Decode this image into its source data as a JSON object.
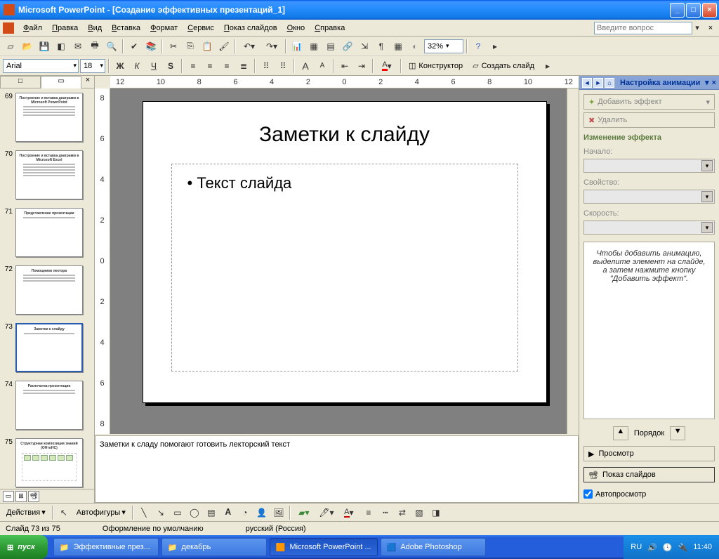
{
  "title": "Microsoft PowerPoint - [Создание эффективных презентаций_1]",
  "menubar": {
    "items": [
      "Файл",
      "Правка",
      "Вид",
      "Вставка",
      "Формат",
      "Сервис",
      "Показ слайдов",
      "Окно",
      "Справка"
    ],
    "ask_placeholder": "Введите вопрос"
  },
  "standard_toolbar": {
    "zoom": "32%"
  },
  "formatting_toolbar": {
    "font_name": "Arial",
    "font_size": "18",
    "designer_label": "Конструктор",
    "new_slide_label": "Создать слайд"
  },
  "ruler_numbers": [
    "12",
    "10",
    "8",
    "6",
    "4",
    "2",
    "0",
    "2",
    "4",
    "6",
    "8",
    "10",
    "12"
  ],
  "vruler_numbers": [
    "8",
    "6",
    "4",
    "2",
    "0",
    "2",
    "4",
    "6",
    "8"
  ],
  "left_pane": {
    "tab_outline": "□",
    "tab_slides": "▭",
    "thumbs": [
      {
        "num": "69",
        "title": "Построение и вставка диаграмм в Microsoft PowerPoint",
        "lines": 4
      },
      {
        "num": "70",
        "title": "Построение и вставка диаграмм в Microsoft Excel",
        "lines": 5
      },
      {
        "num": "71",
        "title": "Представление презентации",
        "lines": 1
      },
      {
        "num": "72",
        "title": "Помощники лектора",
        "lines": 3
      },
      {
        "num": "73",
        "title": "Заметки к слайду",
        "lines": 1,
        "selected": true
      },
      {
        "num": "74",
        "title": "Распечатка презентации",
        "lines": 2
      },
      {
        "num": "75",
        "title": "Структурная композиция знаний (ОНтоНС)",
        "lines": 0,
        "diagram": true
      }
    ]
  },
  "slide": {
    "title": "Заметки к слайду",
    "bullet": "Текст слайда"
  },
  "notes": "Заметки к сладу помогают готовить лекторский текст",
  "task_pane": {
    "title": "Настройка анимации",
    "add_effect_label": "Добавить эффект",
    "delete_label": "Удалить",
    "section": "Изменение эффекта",
    "start_label": "Начало:",
    "property_label": "Свойство:",
    "speed_label": "Скорость:",
    "hint": "Чтобы добавить анимацию, выделите элемент на слайде, а затем нажмите кнопку \"Добавить эффект\".",
    "order_label": "Порядок",
    "preview_label": "Просмотр",
    "slideshow_label": "Показ слайдов",
    "autopreview_label": "Автопросмотр"
  },
  "drawing_toolbar": {
    "actions_label": "Действия",
    "autoshapes_label": "Автофигуры"
  },
  "statusbar": {
    "slide": "Слайд 73 из 75",
    "design": "Оформление по умолчанию",
    "lang": "русский (Россия)"
  },
  "taskbar": {
    "start": "пуск",
    "items": [
      {
        "label": "Эффективные през...",
        "icon": "folder"
      },
      {
        "label": "декабрь",
        "icon": "folder"
      },
      {
        "label": "Microsoft PowerPoint ...",
        "icon": "ppt",
        "active": true
      },
      {
        "label": "Adobe Photoshop",
        "icon": "ps"
      }
    ],
    "lang": "RU",
    "clock": "11:40"
  }
}
